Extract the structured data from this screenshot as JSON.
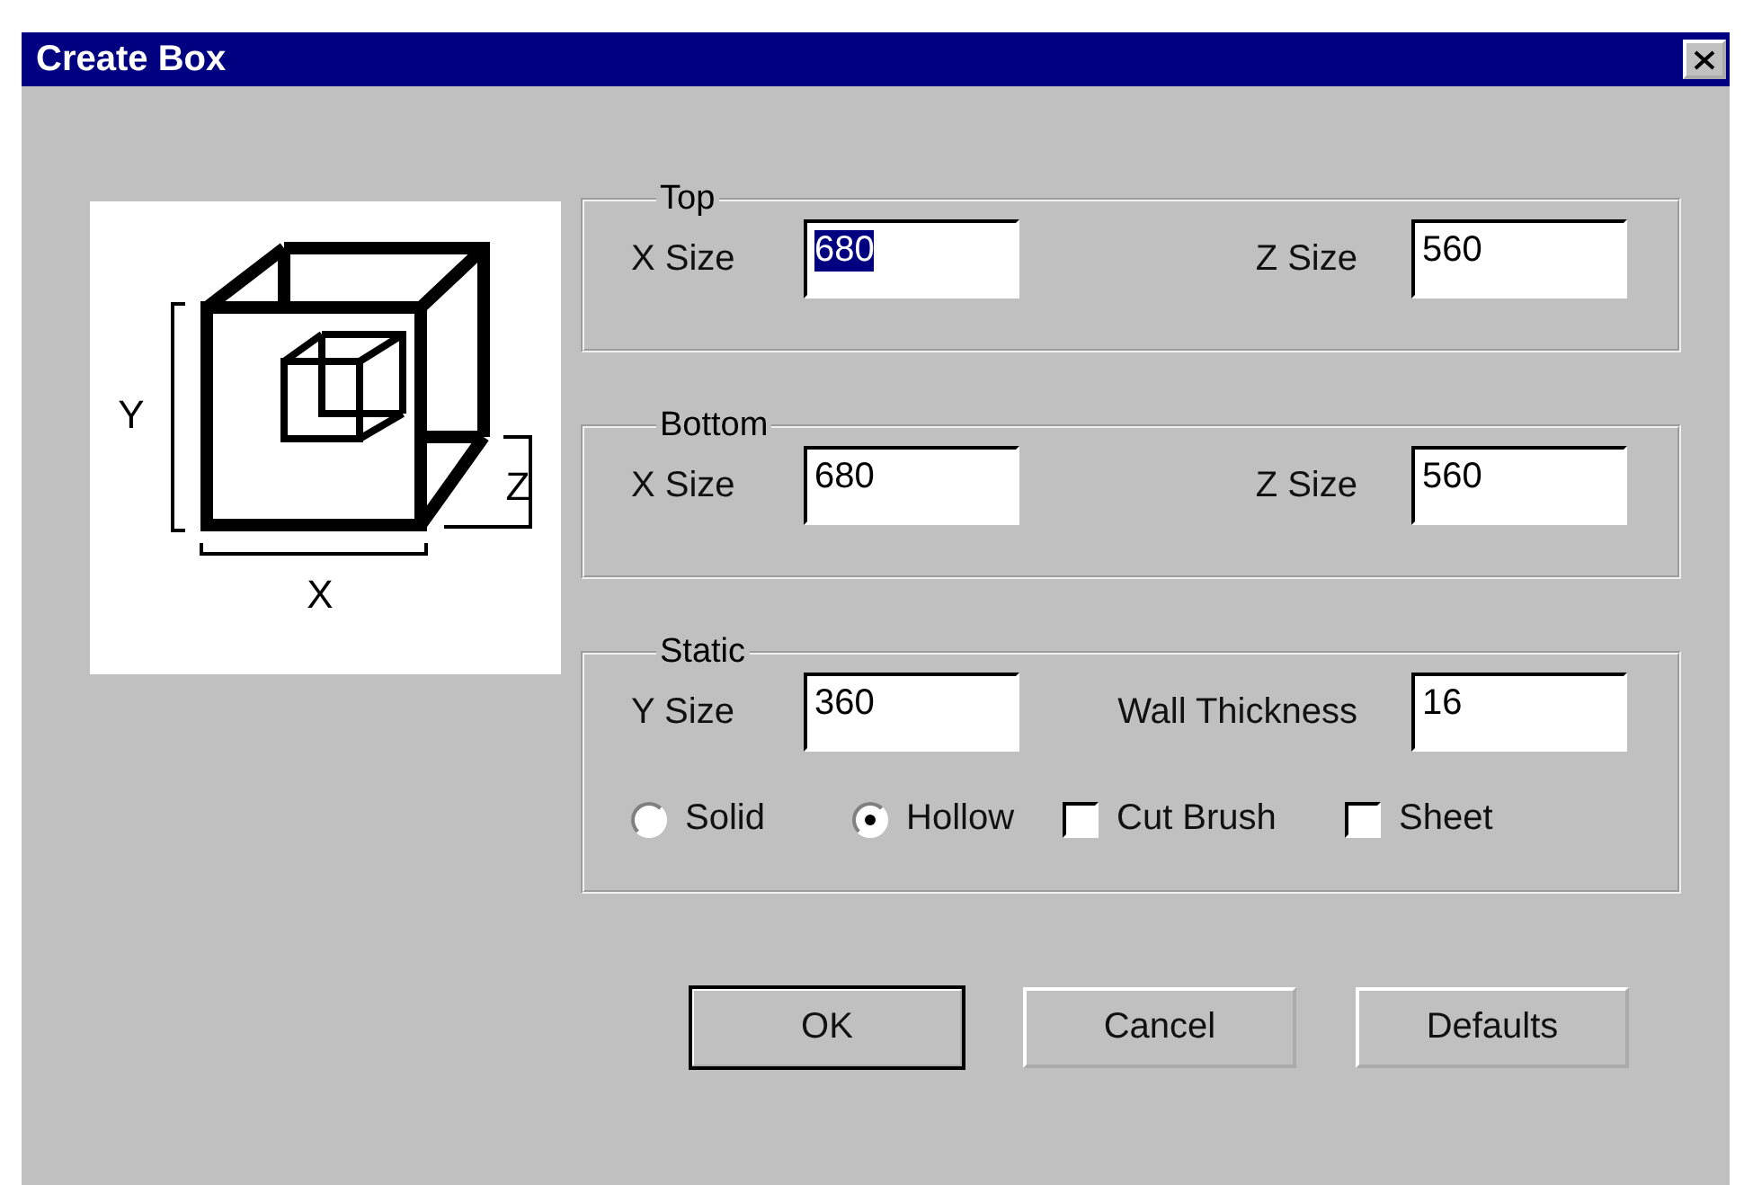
{
  "window": {
    "title": "Create Box"
  },
  "diagram": {
    "axis_labels": [
      "Y",
      "Z",
      "X"
    ]
  },
  "groups": [
    {
      "title": "Top",
      "fields": [
        {
          "label": "X Size",
          "value": "680",
          "text_selected": true
        },
        {
          "label": "Z Size",
          "value": "560",
          "text_selected": false
        }
      ]
    },
    {
      "title": "Bottom",
      "fields": [
        {
          "label": "X Size",
          "value": "680",
          "text_selected": false
        },
        {
          "label": "Z Size",
          "value": "560",
          "text_selected": false
        }
      ]
    },
    {
      "title": "Static",
      "fields": [
        {
          "label": "Y Size",
          "value": "360",
          "text_selected": false
        },
        {
          "label": "Wall Thickness",
          "value": "16",
          "text_selected": false
        }
      ],
      "options": [
        {
          "kind": "radio",
          "label": "Solid",
          "selected": false
        },
        {
          "kind": "radio",
          "label": "Hollow",
          "selected": true
        },
        {
          "kind": "checkbox",
          "label": "Cut Brush",
          "checked": false
        },
        {
          "kind": "checkbox",
          "label": "Sheet",
          "checked": false
        }
      ]
    }
  ],
  "buttons": [
    {
      "label": "OK",
      "default": true
    },
    {
      "label": "Cancel",
      "default": false
    },
    {
      "label": "Defaults",
      "default": false
    }
  ]
}
